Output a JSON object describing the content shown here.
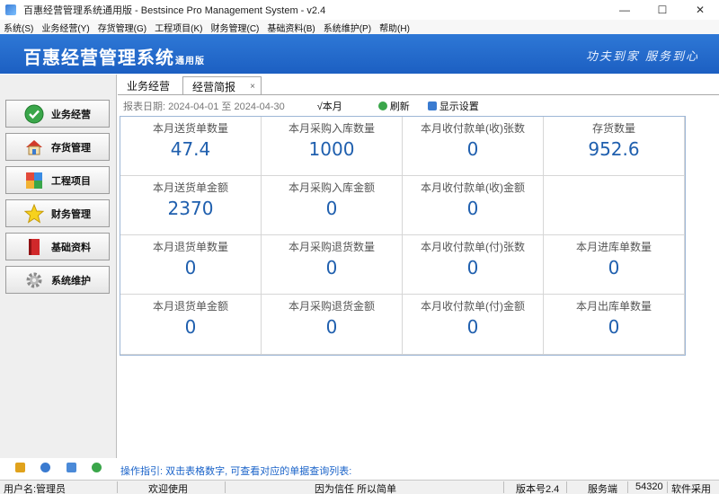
{
  "window": {
    "title": "百惠经营管理系统通用版 - Bestsince Pro Management System - v2.4",
    "minimize": "—",
    "maximize": "☐",
    "close": "✕"
  },
  "menu": [
    "系统(S)",
    "业务经营(Y)",
    "存货管理(G)",
    "工程项目(K)",
    "财务管理(C)",
    "基础资料(B)",
    "系统维护(P)",
    "帮助(H)"
  ],
  "banner": {
    "brand": "百惠经营管理系统",
    "edition": "通用版",
    "slogan": "功夫到家 服务到心"
  },
  "nav": [
    {
      "label": "业务经营",
      "icon": "check-circle-icon"
    },
    {
      "label": "存货管理",
      "icon": "house-icon"
    },
    {
      "label": "工程项目",
      "icon": "project-icon"
    },
    {
      "label": "财务管理",
      "icon": "star-icon"
    },
    {
      "label": "基础资料",
      "icon": "book-icon"
    },
    {
      "label": "系统维护",
      "icon": "gear-icon"
    }
  ],
  "tabs": {
    "tab1": "业务经营",
    "tab2": "经营简报",
    "close": "×"
  },
  "toolbar": {
    "date_range": "报表日期: 2024-04-01 至 2024-04-30",
    "this_month": "√本月",
    "refresh": "刷新",
    "display_settings": "显示设置"
  },
  "cells": [
    {
      "label": "本月送货单数量",
      "value": "47.4"
    },
    {
      "label": "本月采购入库数量",
      "value": "1000"
    },
    {
      "label": "本月收付款单(收)张数",
      "value": "0"
    },
    {
      "label": "存货数量",
      "value": "952.6"
    },
    {
      "label": "本月送货单金额",
      "value": "2370"
    },
    {
      "label": "本月采购入库金额",
      "value": "0"
    },
    {
      "label": "本月收付款单(收)金额",
      "value": "0"
    },
    {
      "label": "",
      "value": ""
    },
    {
      "label": "本月退货单数量",
      "value": "0"
    },
    {
      "label": "本月采购退货数量",
      "value": "0"
    },
    {
      "label": "本月收付款单(付)张数",
      "value": "0"
    },
    {
      "label": "本月进库单数量",
      "value": "0"
    },
    {
      "label": "本月退货单金额",
      "value": "0"
    },
    {
      "label": "本月采购退货金额",
      "value": "0"
    },
    {
      "label": "本月收付款单(付)金额",
      "value": "0"
    },
    {
      "label": "本月出库单数量",
      "value": "0"
    }
  ],
  "hint": "操作指引: 双击表格数字, 可查看对应的单据查询列表:",
  "status": {
    "user": "用户名:管理员",
    "welcome": "欢迎使用",
    "motto": "因为信任 所以简单",
    "version": "版本号2.4",
    "service": "服务端",
    "port": "54320",
    "mode": "软件采用"
  },
  "colors": {
    "banner": "#1c5fc2",
    "value_text": "#1f5fae",
    "hint_text": "#1a63c9"
  }
}
